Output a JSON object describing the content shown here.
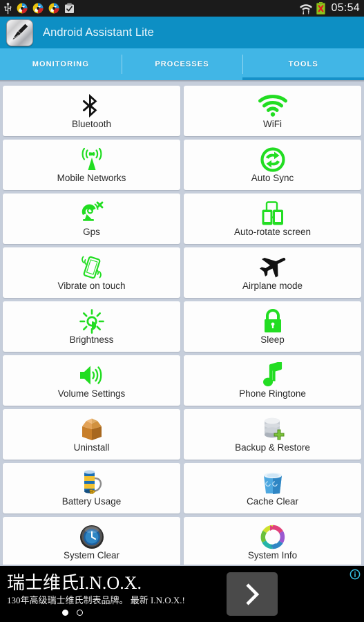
{
  "statusbar": {
    "time": "05:54",
    "left_icons": [
      "usb-icon",
      "sync-icon",
      "sync-icon",
      "sync-icon",
      "clipboard-icon"
    ],
    "right_icons": [
      "wifi-icon",
      "battery-error-icon"
    ]
  },
  "actionbar": {
    "title": "Android Assistant Lite",
    "icon": "broom-app-icon",
    "bg_color": "#0d8fc4"
  },
  "tabs": [
    {
      "label": "MONITORING",
      "active": false
    },
    {
      "label": "PROCESSES",
      "active": false
    },
    {
      "label": "TOOLS",
      "active": true
    }
  ],
  "tab_bar": {
    "bg_color": "#41b6e6",
    "indicator_color": "#1691c8"
  },
  "grid": {
    "accent_green": "#22dd22",
    "rows": [
      [
        {
          "label": "Bluetooth",
          "icon": "bluetooth-icon"
        },
        {
          "label": "WiFi",
          "icon": "wifi-icon"
        }
      ],
      [
        {
          "label": "Mobile Networks",
          "icon": "cell-tower-icon"
        },
        {
          "label": "Auto Sync",
          "icon": "auto-sync-icon"
        }
      ],
      [
        {
          "label": "Gps",
          "icon": "gps-satellite-off-icon"
        },
        {
          "label": "Auto-rotate screen",
          "icon": "auto-rotate-screen-icon"
        }
      ],
      [
        {
          "label": "Vibrate on touch",
          "icon": "vibrate-icon"
        },
        {
          "label": "Airplane mode",
          "icon": "airplane-icon"
        }
      ],
      [
        {
          "label": "Brightness",
          "icon": "brightness-sun-icon"
        },
        {
          "label": "Sleep",
          "icon": "lock-icon"
        }
      ],
      [
        {
          "label": "Volume Settings",
          "icon": "volume-icon"
        },
        {
          "label": "Phone Ringtone",
          "icon": "music-note-icon"
        }
      ],
      [
        {
          "label": "Uninstall",
          "icon": "open-box-icon"
        },
        {
          "label": "Backup & Restore",
          "icon": "database-add-icon"
        }
      ],
      [
        {
          "label": "Battery Usage",
          "icon": "battery-plug-icon"
        },
        {
          "label": "Cache Clear",
          "icon": "recycle-bin-icon"
        }
      ],
      [
        {
          "label": "System Clear",
          "icon": "clock-orb-icon"
        },
        {
          "label": "System Info",
          "icon": "color-refresh-icon"
        }
      ]
    ]
  },
  "ad": {
    "headline": "瑞士维氏I.N.O.X.",
    "subtext": "130年高级瑞士维氏制表品牌。 最新 I.N.O.X.!",
    "cta_icon": "chevron-right-icon",
    "info_icon": "ad-info-icon",
    "dots": [
      true,
      false
    ]
  }
}
